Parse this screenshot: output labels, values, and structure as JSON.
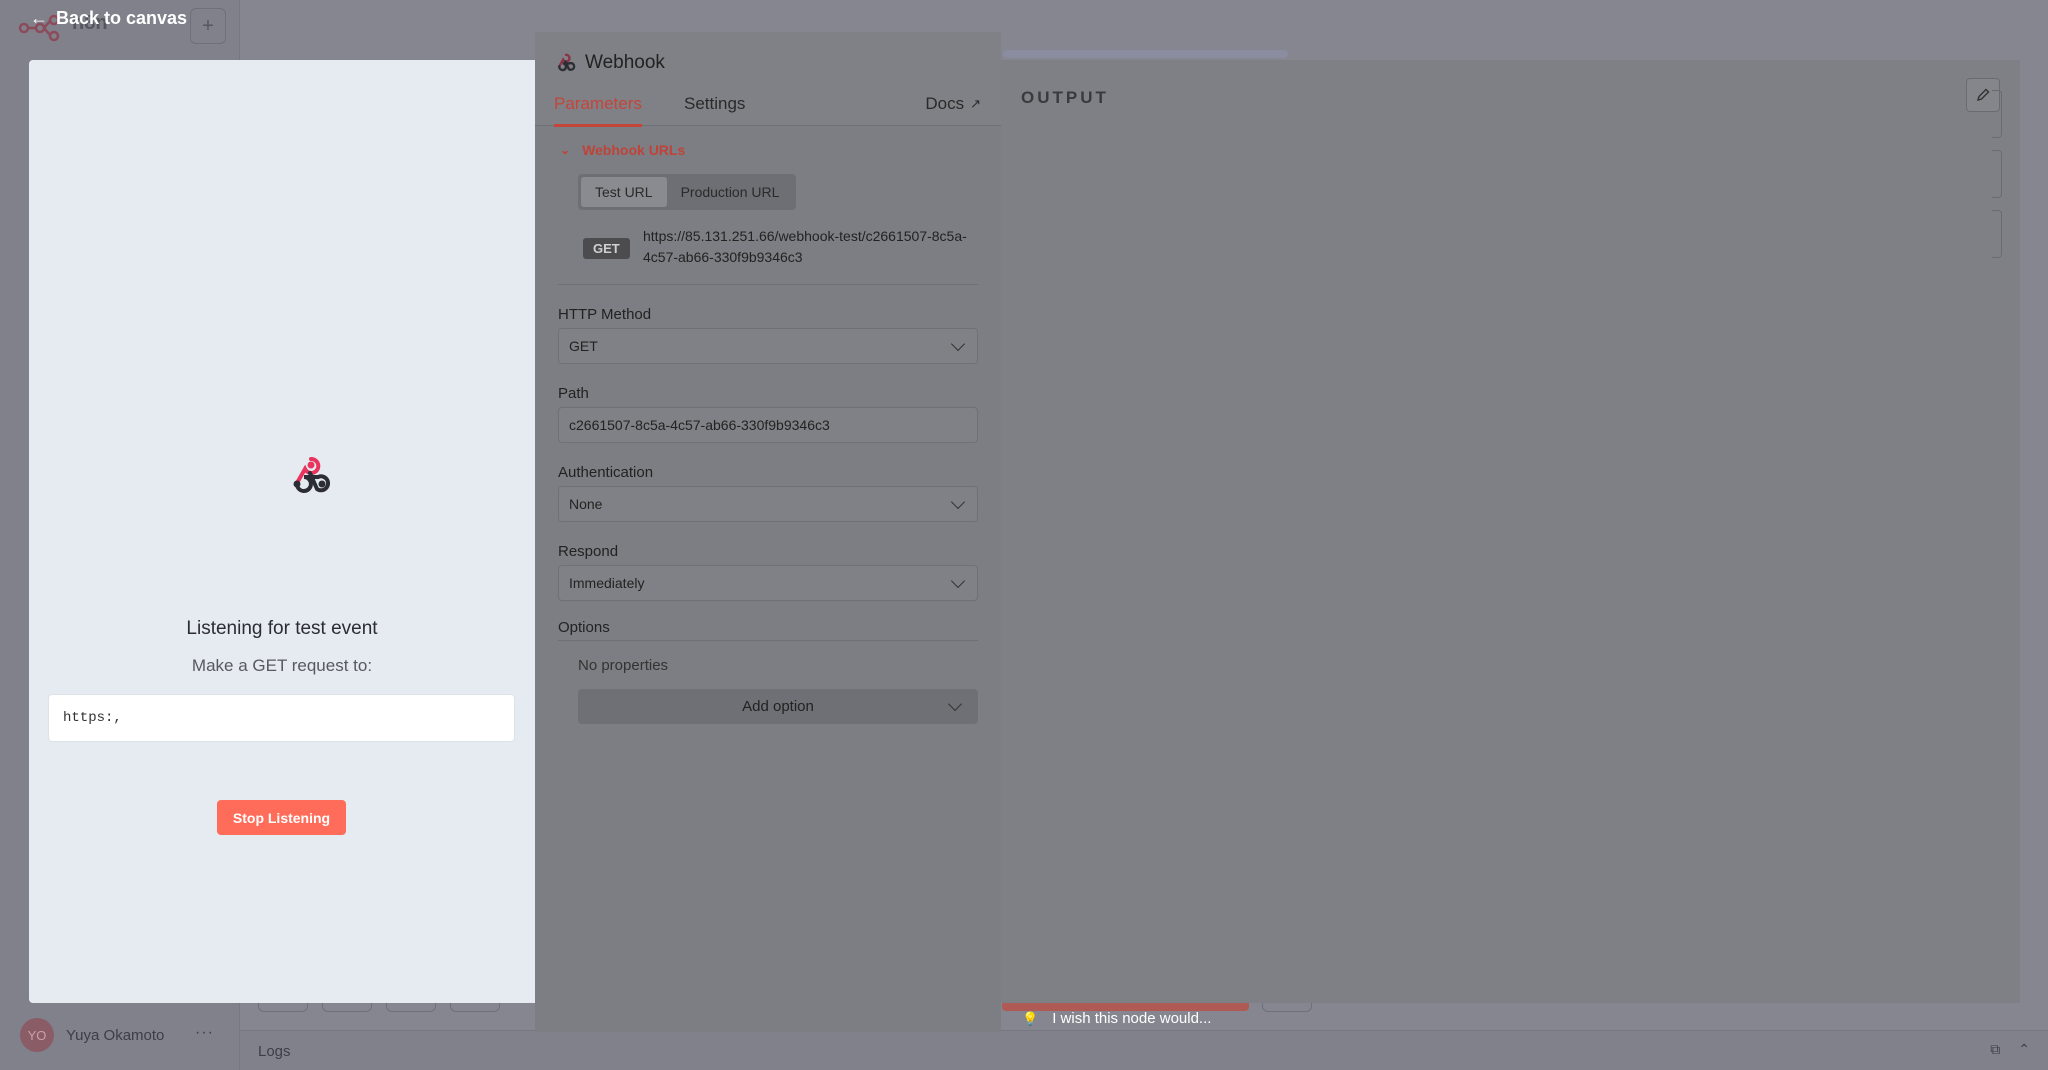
{
  "app": {
    "brand": "n8n",
    "back_label": "Back to canvas",
    "user_initials": "YO",
    "user_name": "Yuya Okamoto",
    "logs_label": "Logs",
    "wish_text": "I wish this node would..."
  },
  "input_panel": {
    "listening_title": "Listening for test event",
    "instruction": "Make a GET request to:",
    "url_preview": "https:,",
    "stop_button": "Stop Listening"
  },
  "node": {
    "title": "Webhook",
    "tabs": [
      "Parameters",
      "Settings"
    ],
    "active_tab": "Parameters",
    "docs_label": "Docs",
    "webhook_urls_label": "Webhook URLs",
    "url_tabs": [
      "Test URL",
      "Production URL"
    ],
    "active_url_tab": "Test URL",
    "method_badge": "GET",
    "webhook_url": "https://85.131.251.66/webhook-test/c2661507-8c5a-4c57-ab66-330f9b9346c3",
    "fields": {
      "http_method": {
        "label": "HTTP Method",
        "value": "GET"
      },
      "path": {
        "label": "Path",
        "value": "c2661507-8c5a-4c57-ab66-330f9b9346c3"
      },
      "authentication": {
        "label": "Authentication",
        "value": "None"
      },
      "respond": {
        "label": "Respond",
        "value": "Immediately"
      }
    },
    "options_label": "Options",
    "no_properties": "No properties",
    "add_option": "Add option"
  },
  "output_panel": {
    "title": "OUTPUT"
  },
  "colors": {
    "accent": "#ff6d5a",
    "accent_text": "#bf4339",
    "input_panel_bg": "#e6ebf2"
  }
}
